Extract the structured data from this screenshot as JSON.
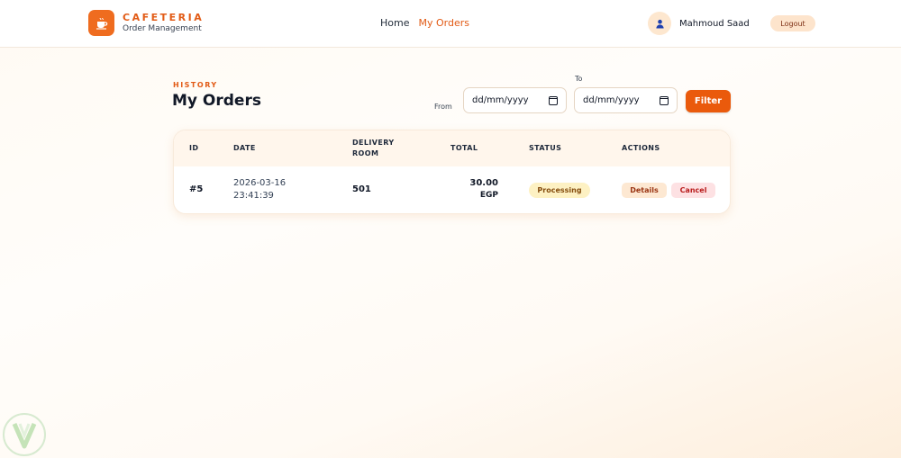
{
  "brand": {
    "name": "CAFETERIA",
    "subtitle": "Order Management",
    "icon": "coffee-cup-icon"
  },
  "nav": {
    "home": "Home",
    "my_orders": "My Orders",
    "active": "my_orders"
  },
  "user": {
    "name": "Mahmoud Saad",
    "avatar_icon": "user-icon",
    "logout": "Logout"
  },
  "page": {
    "section_label": "HISTORY",
    "title": "My Orders"
  },
  "filter": {
    "from_label": "From",
    "to_label": "To",
    "from_placeholder": "dd/mm/yyyy",
    "to_placeholder": "dd/mm/yyyy",
    "button": "Filter"
  },
  "table": {
    "headers": {
      "id": "ID",
      "date": "DATE",
      "room_line1": "DELIVERY",
      "room_line2": "ROOM",
      "total": "TOTAL",
      "status": "STATUS",
      "actions": "ACTIONS"
    },
    "rows": [
      {
        "id": "#5",
        "date": "2026-03-16",
        "time": "23:41:39",
        "room": "501",
        "total_amount": "30.00",
        "total_currency": "EGP",
        "status": "Processing",
        "details": "Details",
        "cancel": "Cancel"
      }
    ]
  },
  "colors": {
    "accent": "#ea5a0c",
    "brand_text": "#e25b16",
    "status_bg": "#fdf1c3",
    "cancel_bg": "#fde1e3"
  }
}
